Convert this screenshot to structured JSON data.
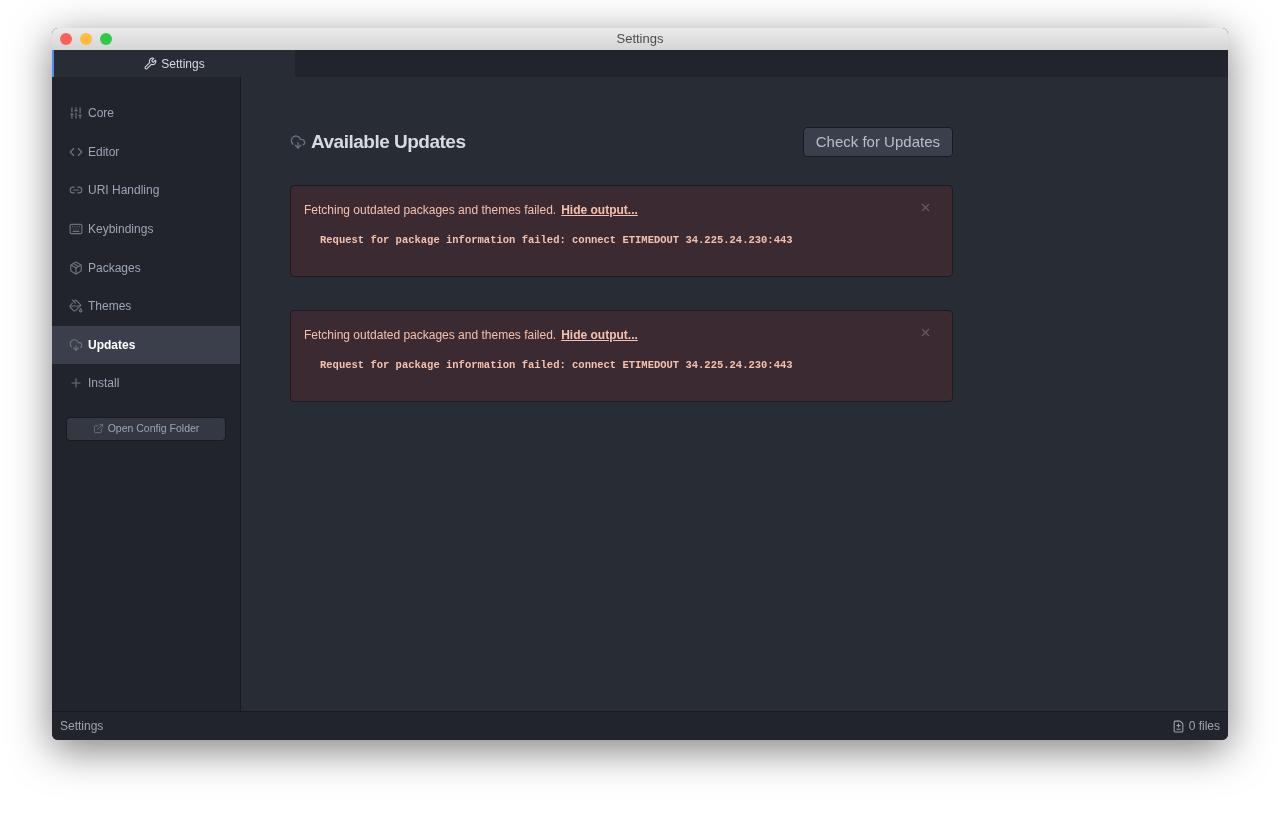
{
  "window": {
    "title": "Settings"
  },
  "tabs": [
    {
      "label": "Settings",
      "selected": true
    }
  ],
  "sidebar": {
    "items": [
      {
        "label": "Core",
        "selected": false
      },
      {
        "label": "Editor",
        "selected": false
      },
      {
        "label": "URI Handling",
        "selected": false
      },
      {
        "label": "Keybindings",
        "selected": false
      },
      {
        "label": "Packages",
        "selected": false
      },
      {
        "label": "Themes",
        "selected": false
      },
      {
        "label": "Updates",
        "selected": true
      },
      {
        "label": "Install",
        "selected": false
      }
    ],
    "button": "Open Config Folder"
  },
  "main": {
    "title": "Available Updates",
    "button": "Check for Updates",
    "alerts": [
      {
        "message": "Fetching outdated packages and themes failed.",
        "link": "Hide output...",
        "output": "Request for package information failed: connect ETIMEDOUT 34.225.24.230:443"
      },
      {
        "message": "Fetching outdated packages and themes failed.",
        "link": "Hide output...",
        "output": "Request for package information failed: connect ETIMEDOUT 34.225.24.230:443"
      }
    ]
  },
  "status_bar": {
    "left": "Settings",
    "right": "0 files"
  }
}
